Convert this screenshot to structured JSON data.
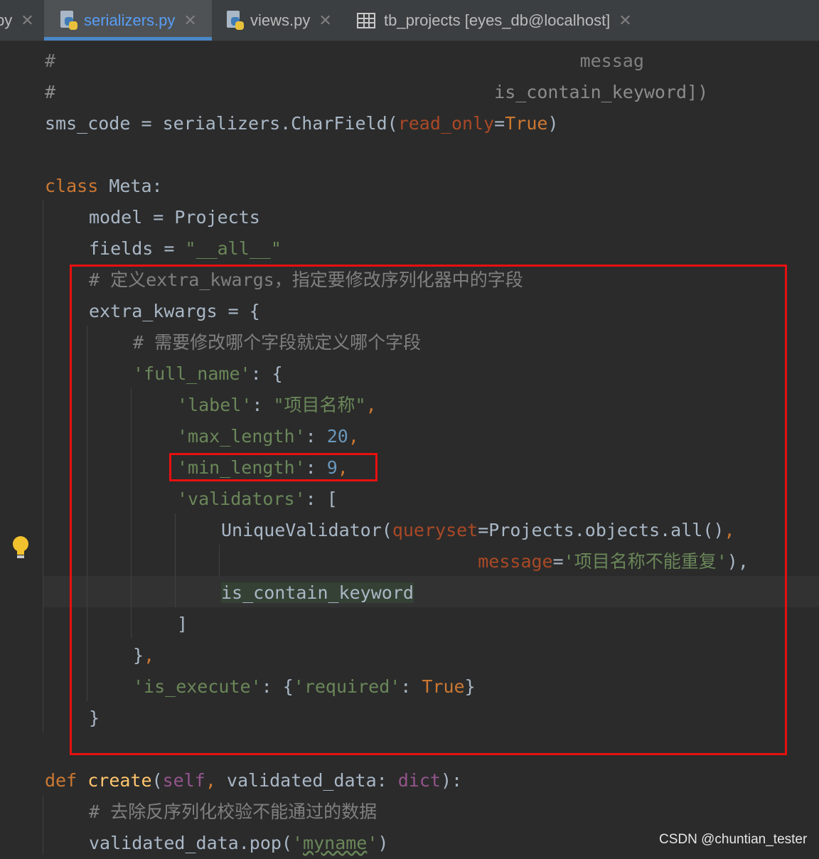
{
  "tabs": [
    {
      "label": "py",
      "icon": "python-file-icon",
      "active": false
    },
    {
      "label": "serializers.py",
      "icon": "python-file-icon",
      "active": true
    },
    {
      "label": "views.py",
      "icon": "python-file-icon",
      "active": false
    },
    {
      "label": "tb_projects [eyes_db@localhost]",
      "icon": "table-icon",
      "active": false
    }
  ],
  "code": {
    "l1": {
      "text": "#                                                 messag"
    },
    "l2": {
      "text": "#                                         is_contain_keyword])"
    },
    "l3": {
      "a": "sms_code = serializers.CharField(",
      "b": "read_only",
      "c": "=",
      "d": "True",
      "e": ")"
    },
    "l5": {
      "a": "class",
      "b": " Meta:"
    },
    "l6": {
      "text": "model = Projects"
    },
    "l7": {
      "a": "fields = ",
      "b": "\"__all__\""
    },
    "l8": {
      "text": "# 定义extra_kwargs，指定要修改序列化器中的字段"
    },
    "l9": {
      "text": "extra_kwargs = {"
    },
    "l10": {
      "text": "# 需要修改哪个字段就定义哪个字段"
    },
    "l11": {
      "a": "'full_name'",
      "b": ": {"
    },
    "l12": {
      "a": "'label'",
      "b": ": ",
      "c": "\"项目名称\"",
      "d": ","
    },
    "l13": {
      "a": "'max_length'",
      "b": ": ",
      "c": "20",
      "d": ","
    },
    "l14": {
      "a": "'min_length'",
      "b": ": ",
      "c": "9",
      "d": ","
    },
    "l15": {
      "a": "'validators'",
      "b": ": ["
    },
    "l16": {
      "a": "UniqueValidator(",
      "b": "queryset",
      "c": "=Projects.objects.all()",
      "d": ","
    },
    "l17": {
      "a": "message",
      "b": "=",
      "c": "'项目名称不能重复'",
      "d": "),",
      "indent": "                        "
    },
    "l18": {
      "text": "is_contain_keyword"
    },
    "l19": {
      "text": "]"
    },
    "l20": {
      "a": "}",
      "b": ","
    },
    "l21": {
      "a": "'is_execute'",
      "b": ": {",
      "c": "'required'",
      "d": ": ",
      "e": "True",
      "f": "}"
    },
    "l22": {
      "text": "}"
    },
    "l24": {
      "a": "def",
      "b": " ",
      "c": "create",
      "d": "(",
      "e": "self",
      "f": ", ",
      "g": "validated_data: ",
      "h": "dict",
      "i": "):"
    },
    "l25": {
      "text": "# 去除反序列化校验不能通过的数据"
    },
    "l26": {
      "a": "validated_data.pop(",
      "b": "'",
      "c": "myname",
      "d": "'",
      "e": ")"
    }
  },
  "watermark": "CSDN @chuntian_tester",
  "colors": {
    "background": "#2b2b2b",
    "keyword": "#cc7832",
    "string": "#6a8759",
    "number": "#6897bb",
    "comment": "#808080",
    "highlight_box": "#e81010",
    "active_tab_text": "#589df6"
  }
}
